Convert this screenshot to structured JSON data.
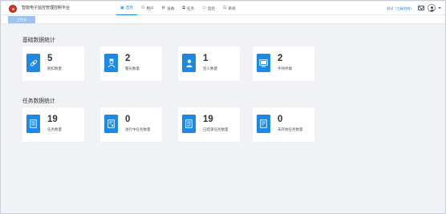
{
  "app": {
    "title": "智能电子监控管理控制平台"
  },
  "nav": [
    {
      "label": "首页",
      "icon": "home-icon",
      "glyph": "▣",
      "active": true
    },
    {
      "label": "用户",
      "icon": "user-icon",
      "glyph": "⚇",
      "active": false
    },
    {
      "label": "设备",
      "icon": "device-icon",
      "glyph": "⚙",
      "active": false
    },
    {
      "label": "任务",
      "icon": "task-icon",
      "glyph": "⧉",
      "active": false
    },
    {
      "label": "监控",
      "icon": "monitor-icon",
      "glyph": "▭",
      "active": false
    },
    {
      "label": "系统",
      "icon": "system-icon",
      "glyph": "☷",
      "active": false
    }
  ],
  "header": {
    "org": "测试（三级机构）"
  },
  "tabs": {
    "work": "工作台"
  },
  "basic": {
    "title": "基础数据统计",
    "cards": [
      {
        "value": "5",
        "label": "腕扣数量",
        "icon": "link-icon"
      },
      {
        "value": "2",
        "label": "警员数量",
        "icon": "officer-icon"
      },
      {
        "value": "1",
        "label": "犯人数量",
        "icon": "prisoner-icon"
      },
      {
        "value": "2",
        "label": "手持终端",
        "icon": "terminal-icon"
      }
    ]
  },
  "task": {
    "title": "任务数据统计",
    "cards": [
      {
        "value": "19",
        "label": "任务数量",
        "icon": "task-doc-icon"
      },
      {
        "value": "0",
        "label": "进行中任务数量",
        "icon": "task-progress-icon"
      },
      {
        "value": "19",
        "label": "已结束任务数量",
        "icon": "task-done-icon"
      },
      {
        "value": "0",
        "label": "未开始任务数量",
        "icon": "task-pending-icon"
      }
    ]
  },
  "colors": {
    "accent": "#1e88e5",
    "tab": "#9ec3ef",
    "background": "#f0f2f5"
  }
}
